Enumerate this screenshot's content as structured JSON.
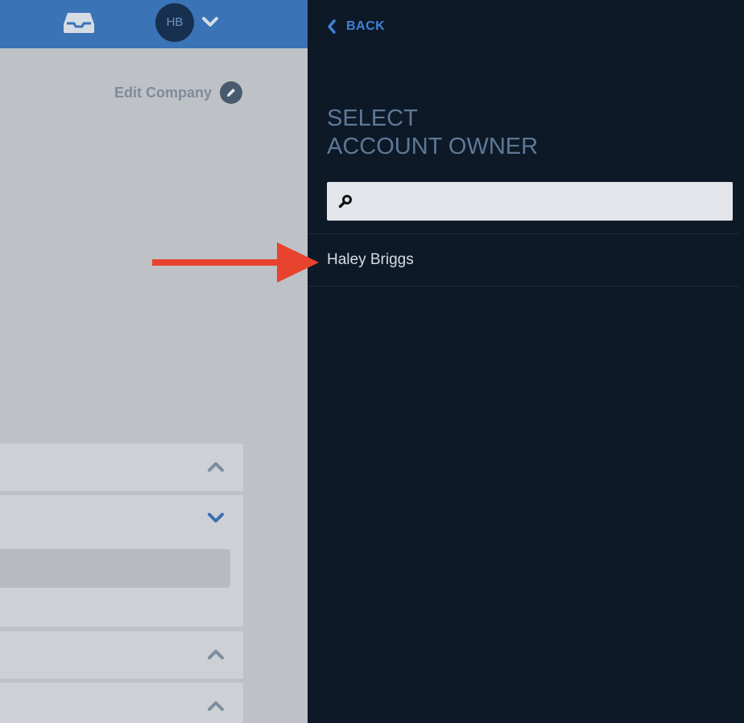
{
  "header": {
    "avatar_initials": "HB"
  },
  "company": {
    "edit_label": "Edit Company"
  },
  "drawer": {
    "back_label": "BACK",
    "title_line1": "SELECT",
    "title_line2": "ACCOUNT OWNER",
    "search": {
      "value": "",
      "placeholder": ""
    },
    "owners": [
      {
        "name": "Haley Briggs"
      }
    ]
  },
  "colors": {
    "topbar": "#3a73b6",
    "drawer_bg": "#0d1927",
    "accent": "#3f82d6",
    "annotation": "#e8432e"
  },
  "icons": {
    "inbox": "inbox-icon",
    "avatar_menu": "chevron-down-icon",
    "edit": "pencil-icon",
    "back": "chevron-left-icon",
    "search": "search-icon",
    "panel_expand": "chevron-up-icon",
    "panel_collapse": "chevron-down-icon"
  }
}
